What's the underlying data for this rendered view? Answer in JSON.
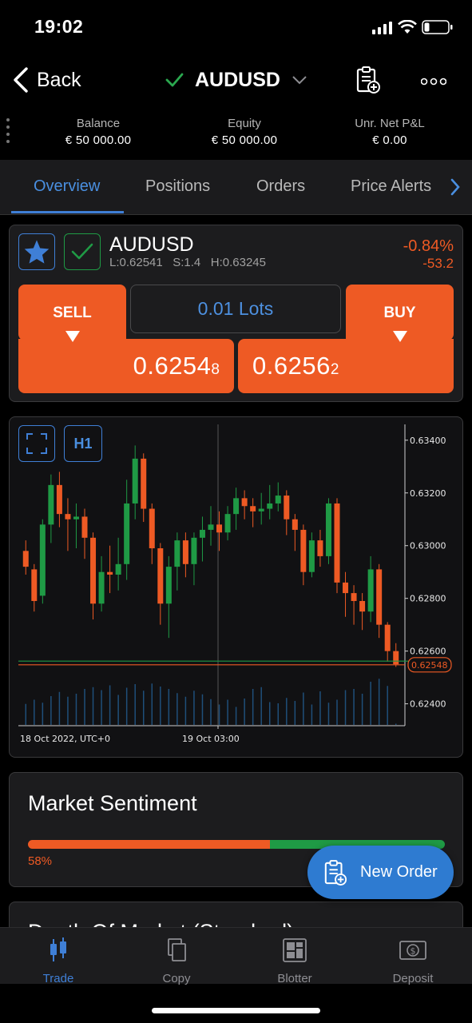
{
  "status_bar": {
    "time": "19:02"
  },
  "header": {
    "back_label": "Back",
    "symbol": "AUDUSD",
    "icons": [
      "checkmark-icon",
      "chevron-down-icon",
      "clipboard-add-icon",
      "more-icon"
    ]
  },
  "account": [
    {
      "label": "Balance",
      "value": "€ 50 000.00"
    },
    {
      "label": "Equity",
      "value": "€ 50 000.00"
    },
    {
      "label": "Unr. Net P&L",
      "value": "€ 0.00"
    }
  ],
  "tabs": [
    {
      "label": "Overview",
      "active": true
    },
    {
      "label": "Positions",
      "active": false
    },
    {
      "label": "Orders",
      "active": false
    },
    {
      "label": "Price Alerts",
      "active": false
    }
  ],
  "instrument": {
    "symbol": "AUDUSD",
    "stats": "L:0.62541   S:1.4   H:0.63245",
    "change_pct": "-0.84%",
    "change_pts": "-53.2",
    "sell_label": "SELL",
    "buy_label": "BUY",
    "lots": "0.01 Lots",
    "sell_price_main": "0.6254",
    "sell_price_pip": "8",
    "buy_price_main": "0.6256",
    "buy_price_pip": "2"
  },
  "chart_controls": {
    "timeframe": "H1"
  },
  "chart_data": {
    "type": "candlestick",
    "y_ticks": [
      "0.63400",
      "0.63200",
      "0.63000",
      "0.62800",
      "0.62600",
      "0.62400"
    ],
    "ylim": [
      0.6232,
      0.6346
    ],
    "x_labels": [
      "18 Oct 2022, UTC+0",
      "19 Oct 03:00"
    ],
    "current_price_label": "0.62548",
    "current_price": 0.62548,
    "ask_price": 0.62562,
    "candles": [
      [
        0.6298,
        0.6292,
        0.6302,
        0.6289
      ],
      [
        0.6291,
        0.6279,
        0.6293,
        0.6275
      ],
      [
        0.6281,
        0.6308,
        0.631,
        0.6278
      ],
      [
        0.6308,
        0.6323,
        0.6327,
        0.6301
      ],
      [
        0.6323,
        0.6312,
        0.6328,
        0.6307
      ],
      [
        0.6312,
        0.631,
        0.6318,
        0.6298
      ],
      [
        0.631,
        0.6311,
        0.6316,
        0.6299
      ],
      [
        0.6311,
        0.6303,
        0.6314,
        0.6295
      ],
      [
        0.6303,
        0.6278,
        0.6305,
        0.6272
      ],
      [
        0.6278,
        0.629,
        0.6296,
        0.6275
      ],
      [
        0.629,
        0.6289,
        0.63,
        0.6282
      ],
      [
        0.6289,
        0.6293,
        0.6303,
        0.6283
      ],
      [
        0.6293,
        0.6316,
        0.6325,
        0.6287
      ],
      [
        0.6316,
        0.6333,
        0.6338,
        0.631
      ],
      [
        0.6333,
        0.6314,
        0.6335,
        0.6309
      ],
      [
        0.6314,
        0.6299,
        0.6316,
        0.6293
      ],
      [
        0.6299,
        0.6278,
        0.6301,
        0.627
      ],
      [
        0.6278,
        0.6292,
        0.6296,
        0.6265
      ],
      [
        0.6292,
        0.6302,
        0.6305,
        0.6283
      ],
      [
        0.6302,
        0.6293,
        0.6305,
        0.6288
      ],
      [
        0.6293,
        0.6303,
        0.6305,
        0.6285
      ],
      [
        0.6303,
        0.6306,
        0.6311,
        0.6294
      ],
      [
        0.6306,
        0.6308,
        0.6315,
        0.63
      ],
      [
        0.6308,
        0.6305,
        0.6313,
        0.6298
      ],
      [
        0.6305,
        0.6312,
        0.6315,
        0.6302
      ],
      [
        0.6312,
        0.6318,
        0.6322,
        0.6306
      ],
      [
        0.6318,
        0.6315,
        0.6321,
        0.631
      ],
      [
        0.6315,
        0.6313,
        0.6318,
        0.6307
      ],
      [
        0.6313,
        0.6314,
        0.632,
        0.6308
      ],
      [
        0.6314,
        0.6316,
        0.6323,
        0.631
      ],
      [
        0.6316,
        0.6319,
        0.6324,
        0.6313
      ],
      [
        0.6319,
        0.631,
        0.6321,
        0.6304
      ],
      [
        0.631,
        0.6306,
        0.6312,
        0.6298
      ],
      [
        0.6306,
        0.629,
        0.6308,
        0.6285
      ],
      [
        0.629,
        0.6302,
        0.6305,
        0.6288
      ],
      [
        0.6302,
        0.6296,
        0.6306,
        0.6292
      ],
      [
        0.6296,
        0.6316,
        0.6318,
        0.6293
      ],
      [
        0.6316,
        0.6286,
        0.6318,
        0.6282
      ],
      [
        0.6286,
        0.6282,
        0.629,
        0.6273
      ],
      [
        0.6282,
        0.6279,
        0.6285,
        0.627
      ],
      [
        0.6279,
        0.6275,
        0.6282,
        0.6268
      ],
      [
        0.6275,
        0.6291,
        0.6296,
        0.6271
      ],
      [
        0.6291,
        0.627,
        0.6293,
        0.6265
      ],
      [
        0.627,
        0.626,
        0.6271,
        0.6256
      ],
      [
        0.626,
        0.6255,
        0.6263,
        0.6254
      ]
    ],
    "volumes": [
      0.35,
      0.42,
      0.37,
      0.48,
      0.55,
      0.47,
      0.52,
      0.6,
      0.63,
      0.58,
      0.66,
      0.5,
      0.62,
      0.68,
      0.57,
      0.69,
      0.64,
      0.6,
      0.53,
      0.47,
      0.57,
      0.51,
      0.43,
      0.34,
      0.42,
      0.3,
      0.44,
      0.6,
      0.63,
      0.38,
      0.36,
      0.45,
      0.4,
      0.54,
      0.34,
      0.56,
      0.37,
      0.42,
      0.58,
      0.6,
      0.52,
      0.72,
      0.77,
      0.65,
      0.02
    ]
  },
  "sentiment": {
    "title": "Market Sentiment",
    "sell_percent_label": "58%",
    "sell_fraction": 0.58,
    "sell_color": "#ee5a24",
    "buy_color": "#1f9a45"
  },
  "next_section_title": "Depth Of Market (Standard)",
  "new_order_label": "New Order",
  "bottom_nav": [
    {
      "label": "Trade",
      "icon": "candlestick-icon",
      "active": true
    },
    {
      "label": "Copy",
      "icon": "copy-icon",
      "active": false
    },
    {
      "label": "Blotter",
      "icon": "blotter-icon",
      "active": false
    },
    {
      "label": "Deposit",
      "icon": "deposit-icon",
      "active": false
    }
  ],
  "colors": {
    "accent": "#3f7fd6",
    "sell": "#ee5a24",
    "buy": "#1f9a45",
    "background": "#000000",
    "panel": "#1c1c1e"
  }
}
